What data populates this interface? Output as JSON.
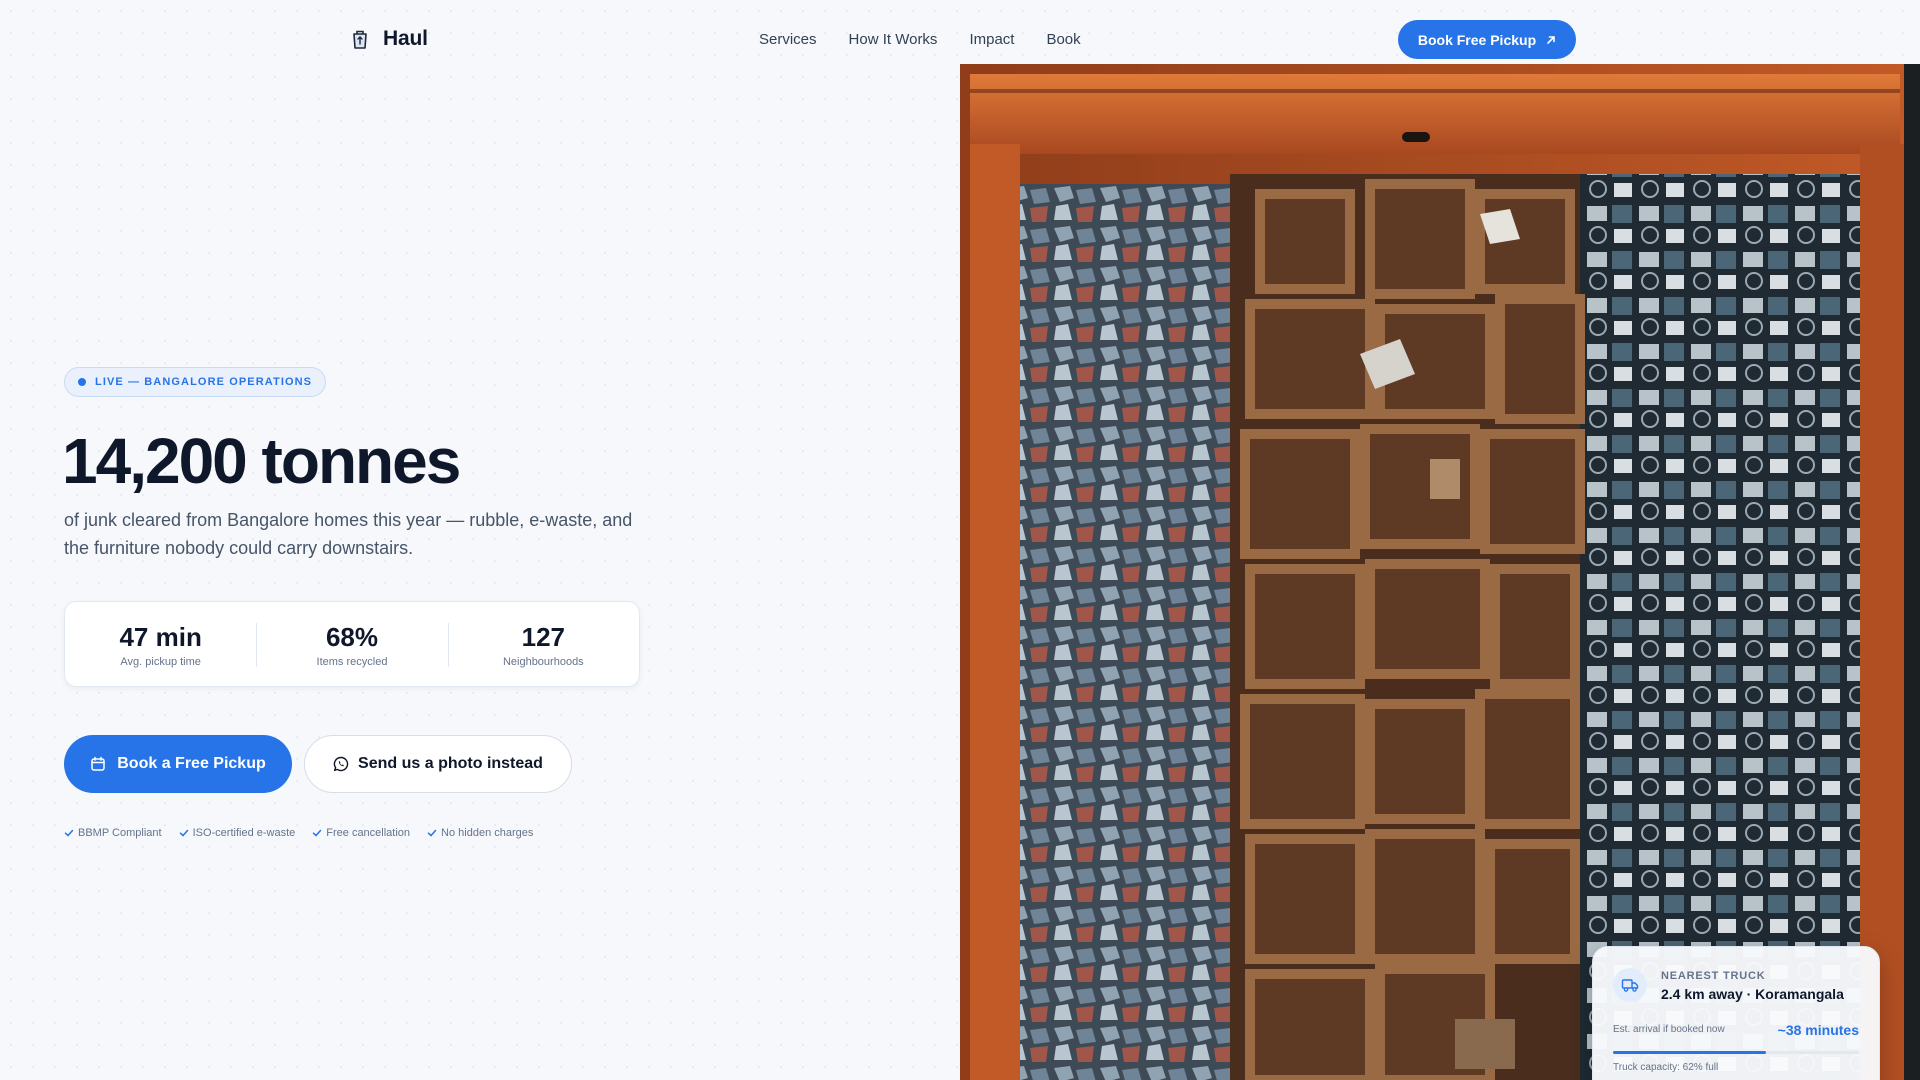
{
  "brand": {
    "name": "Haul",
    "icon": "recycle-bin-icon"
  },
  "nav": {
    "links": [
      "Services",
      "How It Works",
      "Impact",
      "Book"
    ],
    "cta": "Book Free Pickup",
    "cta_icon": "arrow-up-right-icon"
  },
  "hero": {
    "live_badge": "LIVE — BANGALORE OPERATIONS",
    "headline": "14,200 tonnes",
    "subhead": "of junk cleared from Bangalore homes this year — rubble, e-waste, and the furniture nobody could carry downstairs.",
    "stats": [
      {
        "value": "47 min",
        "label": "Avg. pickup time"
      },
      {
        "value": "68%",
        "label": "Items recycled"
      },
      {
        "value": "127",
        "label": "Neighbourhoods"
      }
    ],
    "primary_button": "Book a Free Pickup",
    "primary_icon": "calendar-icon",
    "secondary_button": "Send us a photo instead",
    "secondary_icon": "whatsapp-icon",
    "trust": [
      "BBMP Compliant",
      "ISO-certified e-waste",
      "Free cancellation",
      "No hidden charges"
    ]
  },
  "truck_card": {
    "eyebrow": "NEAREST TRUCK",
    "title": "2.4 km away · Koramangala",
    "eta_label": "Est. arrival if booked now",
    "eta": "~38 minutes",
    "capacity_label": "Truck capacity: 62% full",
    "capacity_fraction": 0.62
  },
  "colors": {
    "accent": "#2774e8",
    "text": "#0f172a",
    "muted": "#64748b",
    "background": "#f6f8fb",
    "dumpster_orange": "#d2622a"
  }
}
